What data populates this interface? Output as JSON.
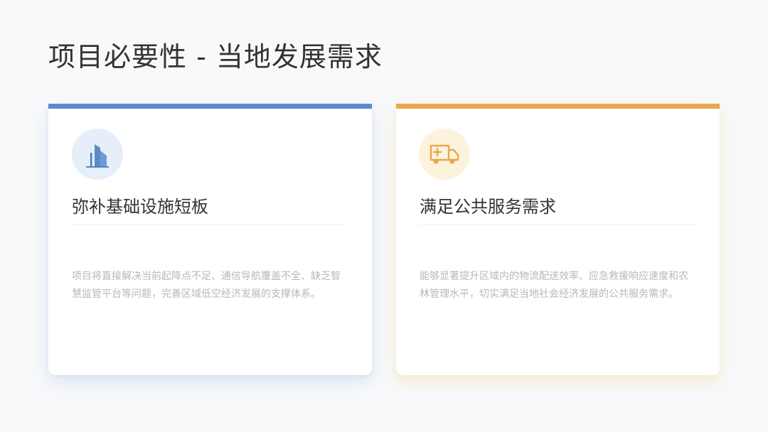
{
  "page": {
    "title": "项目必要性 - 当地发展需求"
  },
  "cards": [
    {
      "icon": "building-icon",
      "accent": "#5b8cc8",
      "title": "弥补基础设施短板",
      "body": "项目将直接解决当前起降点不足、通信导航覆盖不全、缺乏智慧监管平台等问题，完善区域低空经济发展的支撑体系。"
    },
    {
      "icon": "ambulance-icon",
      "accent": "#e8a94a",
      "title": "满足公共服务需求",
      "body": "能够显著提升区域内的物流配送效率、应急救援响应速度和农林管理水平，切实满足当地社会经济发展的公共服务需求。"
    }
  ]
}
